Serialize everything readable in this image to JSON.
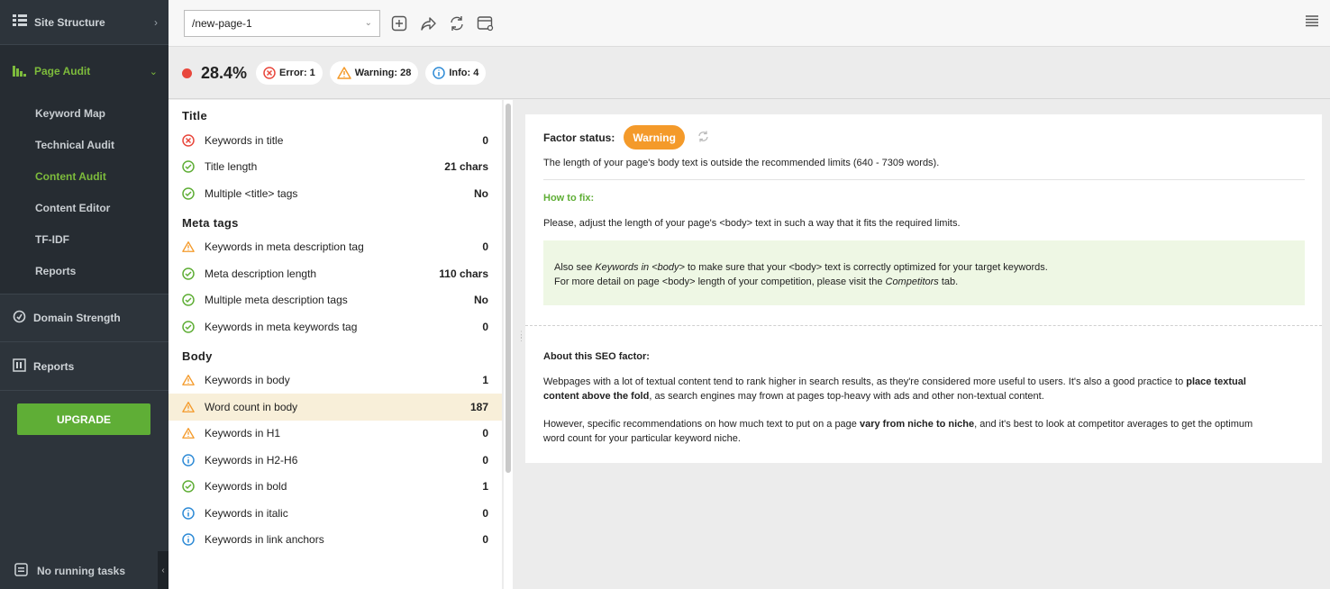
{
  "sidebar": {
    "site_structure": "Site Structure",
    "page_audit": "Page Audit",
    "sub_items": [
      "Keyword Map",
      "Technical Audit",
      "Content Audit",
      "Content Editor",
      "TF-IDF",
      "Reports"
    ],
    "domain_strength": "Domain Strength",
    "reports": "Reports",
    "upgrade": "UPGRADE",
    "tasks": "No running tasks"
  },
  "toolbar": {
    "url": "/new-page-1"
  },
  "status": {
    "score": "28.4%",
    "error": "Error: 1",
    "warning": "Warning: 28",
    "info": "Info: 4"
  },
  "groups": [
    {
      "title": "Title",
      "rows": [
        {
          "name": "Keywords in title",
          "value": "0",
          "status": "error"
        },
        {
          "name": "Title length",
          "value": "21 chars",
          "status": "ok"
        },
        {
          "name": "Multiple <title> tags",
          "value": "No",
          "status": "ok"
        }
      ]
    },
    {
      "title": "Meta tags",
      "rows": [
        {
          "name": "Keywords in meta description tag",
          "value": "0",
          "status": "warning"
        },
        {
          "name": "Meta description length",
          "value": "110 chars",
          "status": "ok"
        },
        {
          "name": "Multiple meta description tags",
          "value": "No",
          "status": "ok"
        },
        {
          "name": "Keywords in meta keywords tag",
          "value": "0",
          "status": "ok"
        }
      ]
    },
    {
      "title": "Body",
      "rows": [
        {
          "name": "Keywords in body",
          "value": "1",
          "status": "warning"
        },
        {
          "name": "Word count in body",
          "value": "187",
          "status": "warning",
          "selected": true
        },
        {
          "name": "Keywords in H1",
          "value": "0",
          "status": "warning"
        },
        {
          "name": "Keywords in H2-H6",
          "value": "0",
          "status": "info"
        },
        {
          "name": "Keywords in bold",
          "value": "1",
          "status": "ok"
        },
        {
          "name": "Keywords in italic",
          "value": "0",
          "status": "info"
        },
        {
          "name": "Keywords in link anchors",
          "value": "0",
          "status": "info"
        }
      ]
    }
  ],
  "detail": {
    "factor_status_label": "Factor status:",
    "factor_status": "Warning",
    "summary": "The length of your page's body text is outside the recommended limits (640 - 7309 words).",
    "how_to_fix": "How to fix:",
    "fix_text": "Please, adjust the length of your page's <body> text in such a way that it fits the required limits.",
    "note_line1_pre": "Also see ",
    "note_line1_em": "Keywords in <body>",
    "note_line1_post": " to make sure that your <body> text is correctly optimized for your target keywords.",
    "note_line2_pre": "For more detail on page <body> length of your competition, please visit the ",
    "note_line2_em": "Competitors",
    "note_line2_post": " tab.",
    "about_title": "About this SEO factor:",
    "about_p1_pre": "Webpages with a lot of textual content tend to rank higher in search results, as they're considered more useful to users. It's also a good practice to ",
    "about_p1_b1": "place textual",
    "about_p1_b2": "content above the fold",
    "about_p1_post": ", as search engines may frown at pages top-heavy with ads and other non-textual content.",
    "about_p2_pre": "However, specific recommendations on how much text to put on a page ",
    "about_p2_b": "vary from niche to niche",
    "about_p2_post": ", and it's best to look at competitor averages to get the optimum",
    "about_p2_line2": "word count for your particular keyword niche."
  },
  "colors": {
    "accent_green": "#5fae36",
    "warning": "#f49a2a",
    "error": "#e8473c",
    "info": "#2f8bd6",
    "sidebar_bg": "#2d343b"
  }
}
